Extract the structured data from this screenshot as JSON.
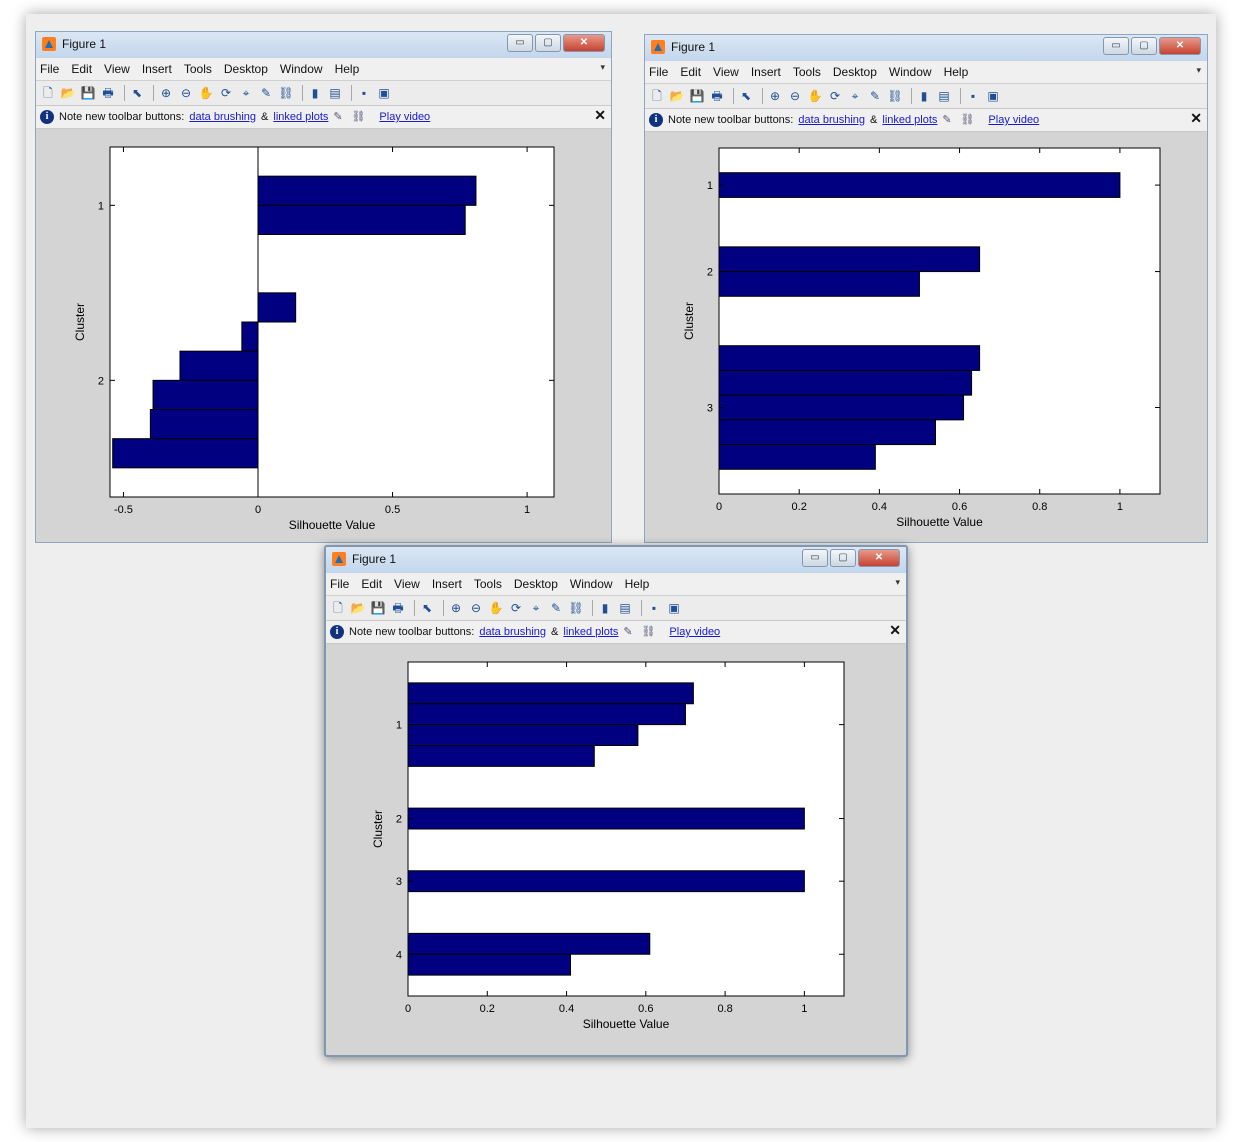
{
  "window": {
    "title": "Figure 1",
    "buttons": [
      "▭",
      "▢",
      "✕"
    ],
    "menu": [
      "File",
      "Edit",
      "View",
      "Insert",
      "Tools",
      "Desktop",
      "Window",
      "Help"
    ],
    "menu_arrow": "▾",
    "toolbar_icons": [
      "new-figure-icon",
      "open-file-icon",
      "save-icon",
      "print-icon",
      "edit-plot-icon",
      "zoom-in-icon",
      "zoom-out-icon",
      "pan-icon",
      "rotate-3d-icon",
      "data-cursor-icon",
      "brush-icon",
      "link-icon",
      "colorbar-icon",
      "legend-icon",
      "hide-plot-tools-icon",
      "show-plot-tools-icon"
    ],
    "note": {
      "info_glyph": "i",
      "text": "Note new toolbar buttons:",
      "link1": "data brushing",
      "amp": "&",
      "link2": "linked plots",
      "video": "Play video",
      "close": "✕"
    }
  },
  "chart_data": [
    {
      "type": "bar",
      "orientation": "horizontal",
      "xlabel": "Silhouette Value",
      "ylabel": "Cluster",
      "xlim": [
        -0.55,
        1.1
      ],
      "xticks": [
        "-0.5",
        "0",
        "0.5",
        "1"
      ],
      "xtick_values": [
        -0.5,
        0,
        0.5,
        1
      ],
      "yticks": [
        "1",
        "2"
      ],
      "clusters": [
        {
          "label": "1",
          "values": [
            0.81,
            0.77
          ]
        },
        {
          "label": "2",
          "values": [
            0.14,
            -0.06,
            -0.29,
            -0.39,
            -0.4,
            -0.54
          ]
        }
      ],
      "bar_color": "#000080"
    },
    {
      "type": "bar",
      "orientation": "horizontal",
      "xlabel": "Silhouette Value",
      "ylabel": "Cluster",
      "xlim": [
        0,
        1.1
      ],
      "xticks": [
        "0",
        "0.2",
        "0.4",
        "0.6",
        "0.8",
        "1"
      ],
      "xtick_values": [
        0,
        0.2,
        0.4,
        0.6,
        0.8,
        1
      ],
      "yticks": [
        "1",
        "2",
        "3"
      ],
      "clusters": [
        {
          "label": "1",
          "values": [
            1.0
          ]
        },
        {
          "label": "2",
          "values": [
            0.65,
            0.5
          ]
        },
        {
          "label": "3",
          "values": [
            0.65,
            0.63,
            0.61,
            0.54,
            0.39
          ]
        }
      ],
      "bar_color": "#000080"
    },
    {
      "type": "bar",
      "orientation": "horizontal",
      "xlabel": "Silhouette Value",
      "ylabel": "Cluster",
      "xlim": [
        0,
        1.1
      ],
      "xticks": [
        "0",
        "0.2",
        "0.4",
        "0.6",
        "0.8",
        "1"
      ],
      "xtick_values": [
        0,
        0.2,
        0.4,
        0.6,
        0.8,
        1
      ],
      "yticks": [
        "1",
        "2",
        "3",
        "4"
      ],
      "clusters": [
        {
          "label": "1",
          "values": [
            0.72,
            0.7,
            0.58,
            0.47
          ]
        },
        {
          "label": "2",
          "values": [
            1.0
          ]
        },
        {
          "label": "3",
          "values": [
            1.0
          ]
        },
        {
          "label": "4",
          "values": [
            0.61,
            0.41
          ]
        }
      ],
      "bar_color": "#000080"
    }
  ]
}
